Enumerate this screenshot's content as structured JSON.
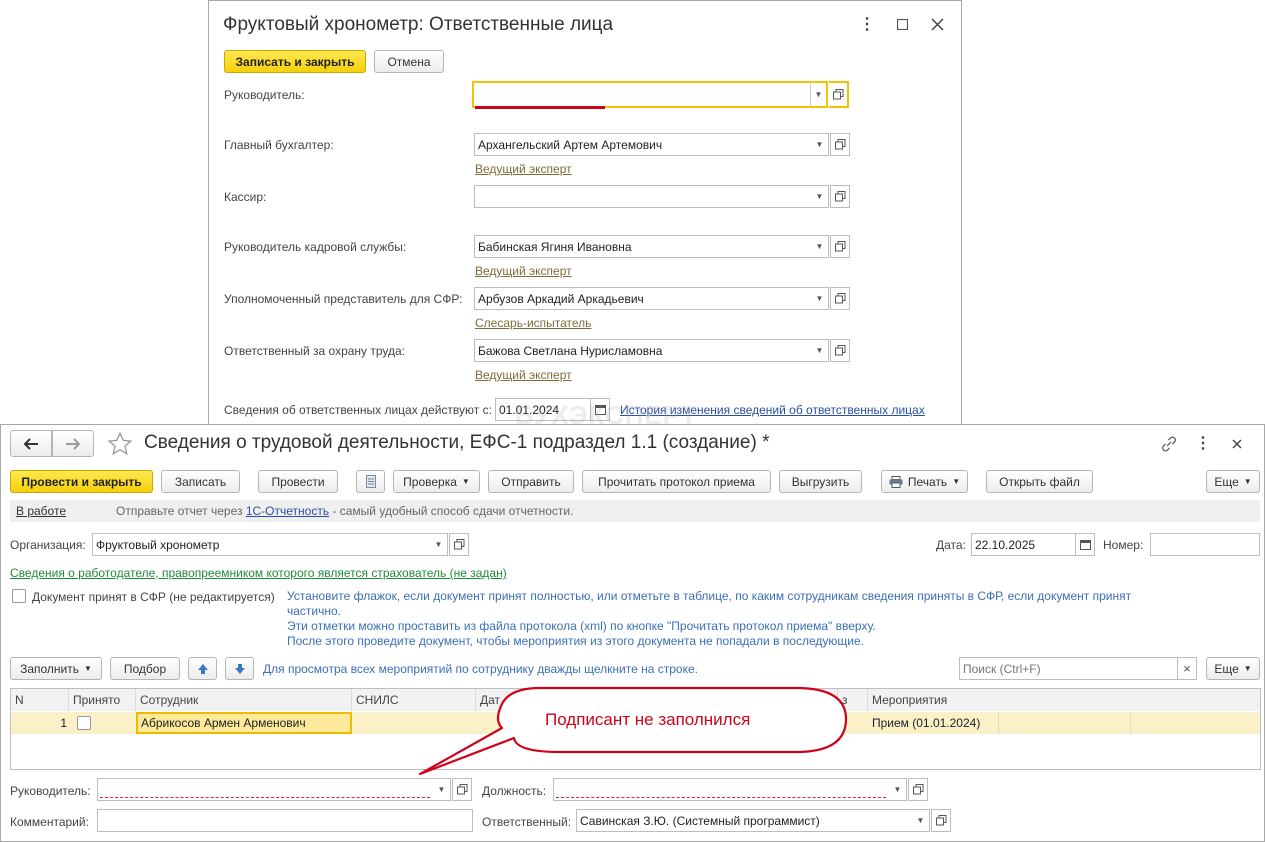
{
  "top_window": {
    "title": "Фруктовый хронометр: Ответственные лица",
    "save_close": "Записать и закрыть",
    "cancel": "Отмена",
    "fields": [
      {
        "label": "Руководитель:",
        "value": "",
        "position_link": ""
      },
      {
        "label": "Главный бухгалтер:",
        "value": "Архангельский Артем Артемович",
        "position_link": "Ведущий эксперт"
      },
      {
        "label": "Кассир:",
        "value": "",
        "position_link": ""
      },
      {
        "label": "Руководитель кадровой службы:",
        "value": "Бабинская Ягиня Ивановна",
        "position_link": "Ведущий эксперт"
      },
      {
        "label": "Уполномоченный представитель для СФР:",
        "value": "Арбузов Аркадий Аркадьевич",
        "position_link": "Слесарь-испытатель"
      },
      {
        "label": "Ответственный за охрану труда:",
        "value": "Бажова Светлана Нурисламовна",
        "position_link": "Ведущий эксперт"
      }
    ],
    "effective_label": "Сведения об ответственных лицах действуют с:",
    "effective_date": "01.01.2024",
    "history_link": "История изменения сведений об ответственных лицах"
  },
  "watermark": "БУХЭКСПЕРТ",
  "main_window": {
    "title": "Сведения о трудовой деятельности, ЕФС-1 подраздел 1.1 (создание) *",
    "toolbar": {
      "post_close": "Провести и закрыть",
      "save": "Записать",
      "post": "Провести",
      "check": "Проверка",
      "send": "Отправить",
      "read_protocol": "Прочитать протокол приема",
      "export": "Выгрузить",
      "print": "Печать",
      "open_file": "Открыть файл",
      "more": "Еще"
    },
    "status": {
      "state_link": "В работе",
      "text_before": "Отправьте отчет через ",
      "service_link": "1С-Отчетность",
      "text_after": " - самый удобный способ сдачи отчетности."
    },
    "org_label": "Организация:",
    "org_value": "Фруктовый хронометр",
    "date_label": "Дата:",
    "date_value": "22.10.2025",
    "number_label": "Номер:",
    "number_value": "",
    "employer_link": "Сведения о работодателе, правопреемником которого является страхователь (не задан)",
    "accepted_checkbox_label": "Документ принят в СФР (не редактируется)",
    "hint_lines": [
      "Установите флажок, если документ принят полностью, или отметьте в таблице, по каким сотрудникам сведения приняты в СФР, если документ принят",
      "частично.",
      "Эти отметки можно проставить из файла протокола (xml) по кнопке \"Прочитать протокол приема\" вверху.",
      "После этого проведите документ, чтобы мероприятия из этого документа не попадали в последующие."
    ],
    "table_toolbar": {
      "fill": "Заполнить",
      "select": "Подбор",
      "hint": "Для просмотра всех мероприятий по сотруднику дважды щелкните на строке.",
      "search_placeholder": "Поиск (Ctrl+F)",
      "more": "Еще"
    },
    "columns": [
      "N",
      "Принято",
      "Сотрудник",
      "СНИЛС",
      "Дат",
      "з",
      "Мероприятия"
    ],
    "rows": [
      {
        "n": "1",
        "accepted": false,
        "employee": "Абрикосов Армен Арменович",
        "snils": "",
        "events": "Прием (01.01.2024)"
      }
    ],
    "footer": {
      "manager_label": "Руководитель:",
      "manager_value": "",
      "position_label": "Должность:",
      "position_value": "",
      "comment_label": "Комментарий:",
      "comment_value": "",
      "responsible_label": "Ответственный:",
      "responsible_value": "Савинская З.Ю. (Системный программист)"
    }
  },
  "callout": {
    "text": "Подписант не заполнился",
    "color": "#d0021b"
  },
  "colors": {
    "accent_yellow": "#f5cf0d",
    "error_red": "#d0021b",
    "link_blue": "#2a4fa3",
    "link_green": "#1f8a3a"
  }
}
